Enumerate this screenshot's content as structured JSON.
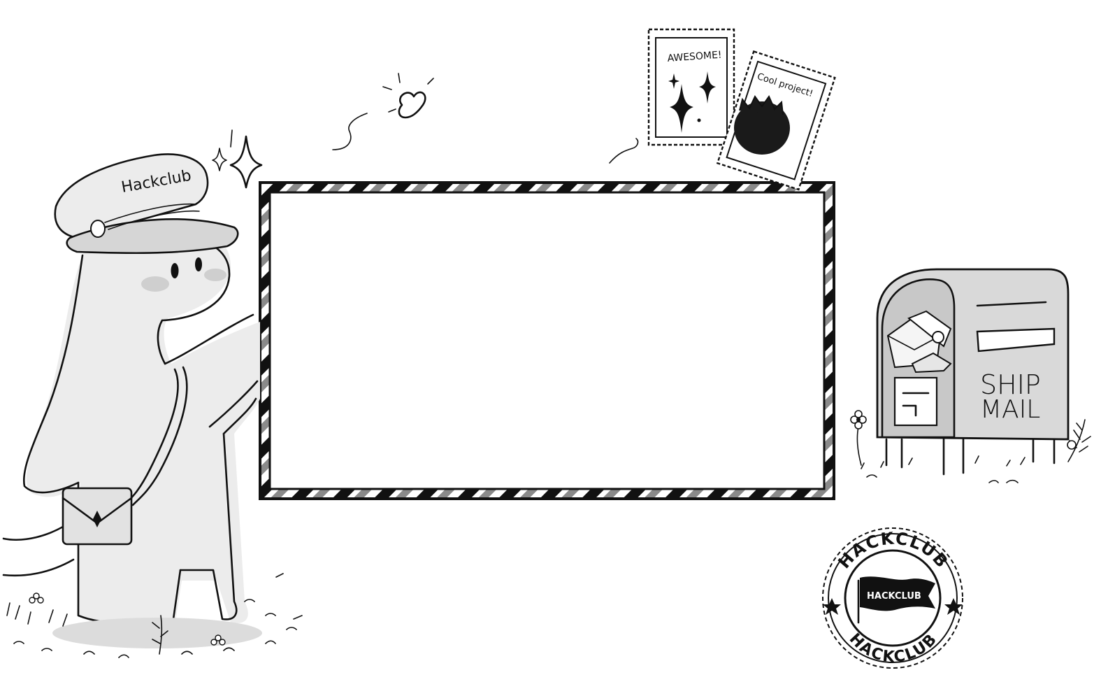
{
  "colors": {
    "ink": "#111111",
    "paper": "#ffffff",
    "shade": "#dcdcdc",
    "shade_light": "#ececec",
    "blush": "#cfcfcf",
    "frame_stripe": "#888888"
  },
  "mascot": {
    "cap_text": "Hackclub",
    "icons": [
      "sparkle-icon",
      "butterfly-icon"
    ]
  },
  "stamps": {
    "awesome_text": "AWESOME!",
    "cool_text": "Cool project!"
  },
  "mailbox": {
    "line1": "SHIP",
    "line2": "MAIL"
  },
  "seal": {
    "top_text": "HACKCLUB",
    "bottom_text": "HACKCLUB",
    "flag_text": "HACKCLUB"
  }
}
